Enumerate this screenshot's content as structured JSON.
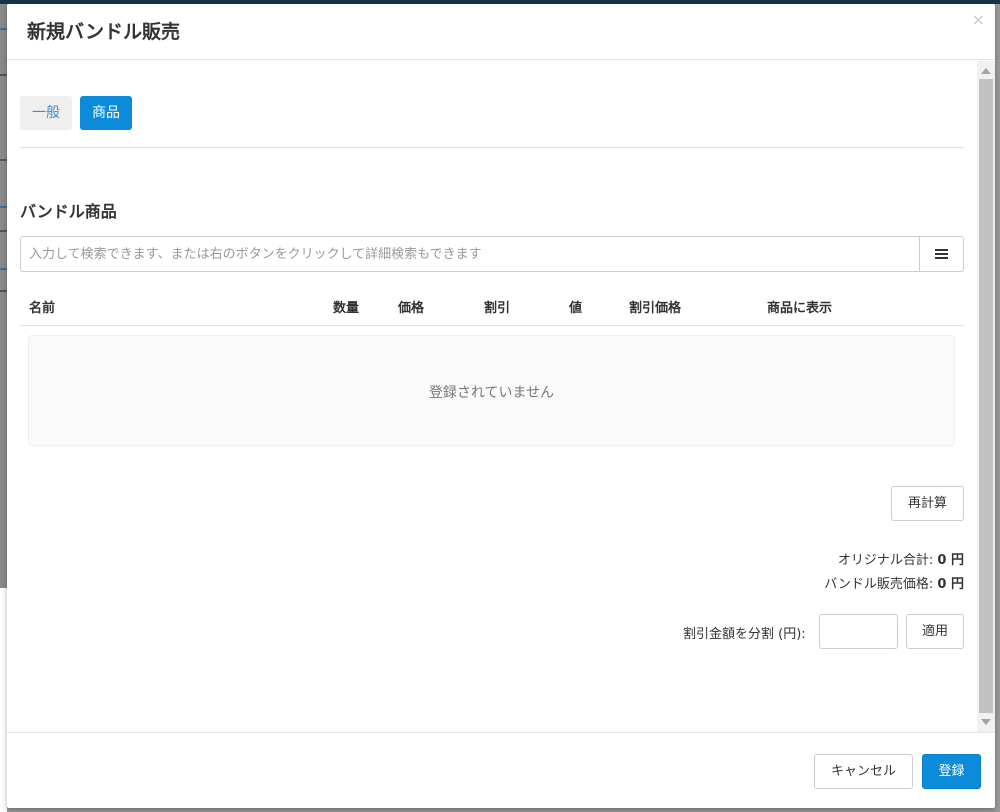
{
  "modal": {
    "title": "新規バンドル販売",
    "close_glyph": "×"
  },
  "tabs": [
    {
      "label": "一般",
      "active": false
    },
    {
      "label": "商品",
      "active": true
    }
  ],
  "section": {
    "title": "バンドル商品"
  },
  "search": {
    "placeholder": "入力して検索できます、または右のボタンをクリックして詳細検索もできます",
    "value": ""
  },
  "table": {
    "columns": [
      "名前",
      "数量",
      "価格",
      "割引",
      "値",
      "割引価格",
      "商品に表示"
    ],
    "empty_message": "登録されていません"
  },
  "buttons": {
    "recalc": "再計算",
    "apply": "適用",
    "cancel": "キャンセル",
    "register": "登録"
  },
  "totals": {
    "original_label": "オリジナル合計:",
    "original_value": "0 円",
    "bundle_label": "バンドル販売価格:",
    "bundle_value": "0 円"
  },
  "split": {
    "label": "割引金額を分割 (円):",
    "value": ""
  },
  "colors": {
    "primary": "#0b8bd9",
    "link": "#3d8ec9",
    "header_bar": "#173348"
  },
  "icons": {
    "menu": "menu-icon",
    "close": "close-icon"
  }
}
